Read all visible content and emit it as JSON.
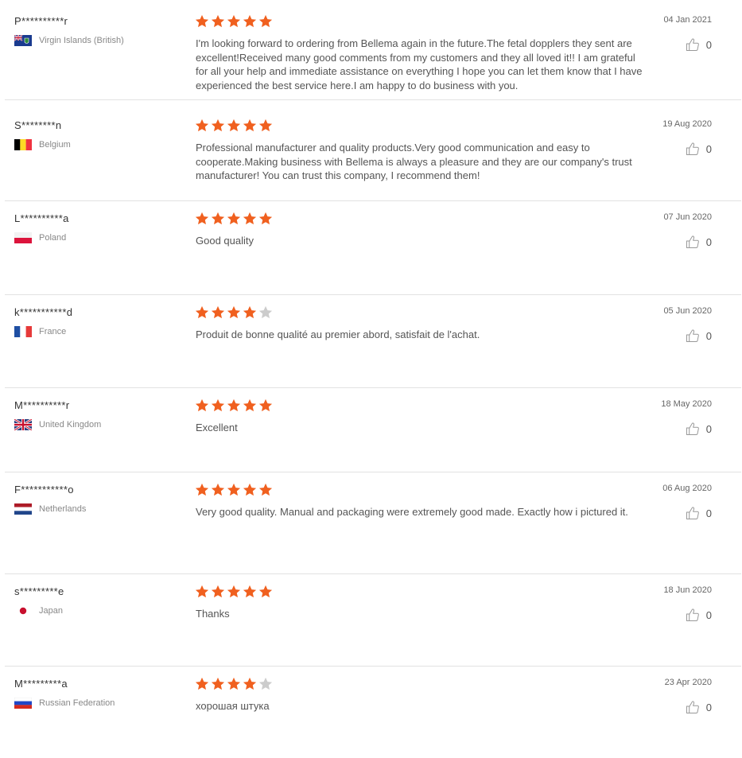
{
  "colors": {
    "star_filled": "#f0601f",
    "star_empty": "#cccccc",
    "divider": "#e2e2e2"
  },
  "reviews": [
    {
      "name": "P**********r",
      "country": "Virgin Islands (British)",
      "flag": "vg-flag-icon",
      "rating": 5,
      "text": "I'm looking forward to ordering from Bellema again in the future.The fetal dopplers they sent are excellent!Received many good comments from my customers and they all loved it!! I am grateful for all your help and immediate assistance on everything I hope you can let them know that I have experienced the best service here.I am happy to do business with you.",
      "date": "04 Jan 2021",
      "likes": "0"
    },
    {
      "name": "S********n",
      "country": "Belgium",
      "flag": "be-flag-icon",
      "rating": 5,
      "text": "Professional manufacturer and quality products.Very good communication and easy to cooperate.Making business with Bellema is always a pleasure and they are our company's trust manufacturer! You can trust this company, I recommend them!",
      "date": "19 Aug 2020",
      "likes": "0"
    },
    {
      "name": "L**********a",
      "country": "Poland",
      "flag": "pl-flag-icon",
      "rating": 5,
      "text": "Good quality",
      "date": "07 Jun 2020",
      "likes": "0"
    },
    {
      "name": "k***********d",
      "country": "France",
      "flag": "fr-flag-icon",
      "rating": 4,
      "text": "Produit de bonne qualité au premier abord, satisfait de l'achat.",
      "date": "05 Jun 2020",
      "likes": "0"
    },
    {
      "name": "M**********r",
      "country": "United Kingdom",
      "flag": "gb-flag-icon",
      "rating": 5,
      "text": "Excellent",
      "date": "18 May 2020",
      "likes": "0"
    },
    {
      "name": "F***********o",
      "country": "Netherlands",
      "flag": "nl-flag-icon",
      "rating": 5,
      "text": "Very good quality. Manual and packaging were extremely good made. Exactly how i pictured it.",
      "date": "06 Aug 2020",
      "likes": "0"
    },
    {
      "name": "s*********e",
      "country": "Japan",
      "flag": "jp-flag-icon",
      "rating": 5,
      "text": "Thanks",
      "date": "18 Jun 2020",
      "likes": "0"
    },
    {
      "name": "M*********a",
      "country": "Russian Federation",
      "flag": "ru-flag-icon",
      "rating": 4,
      "text": "хорошая штука",
      "date": "23 Apr 2020",
      "likes": "0"
    }
  ]
}
